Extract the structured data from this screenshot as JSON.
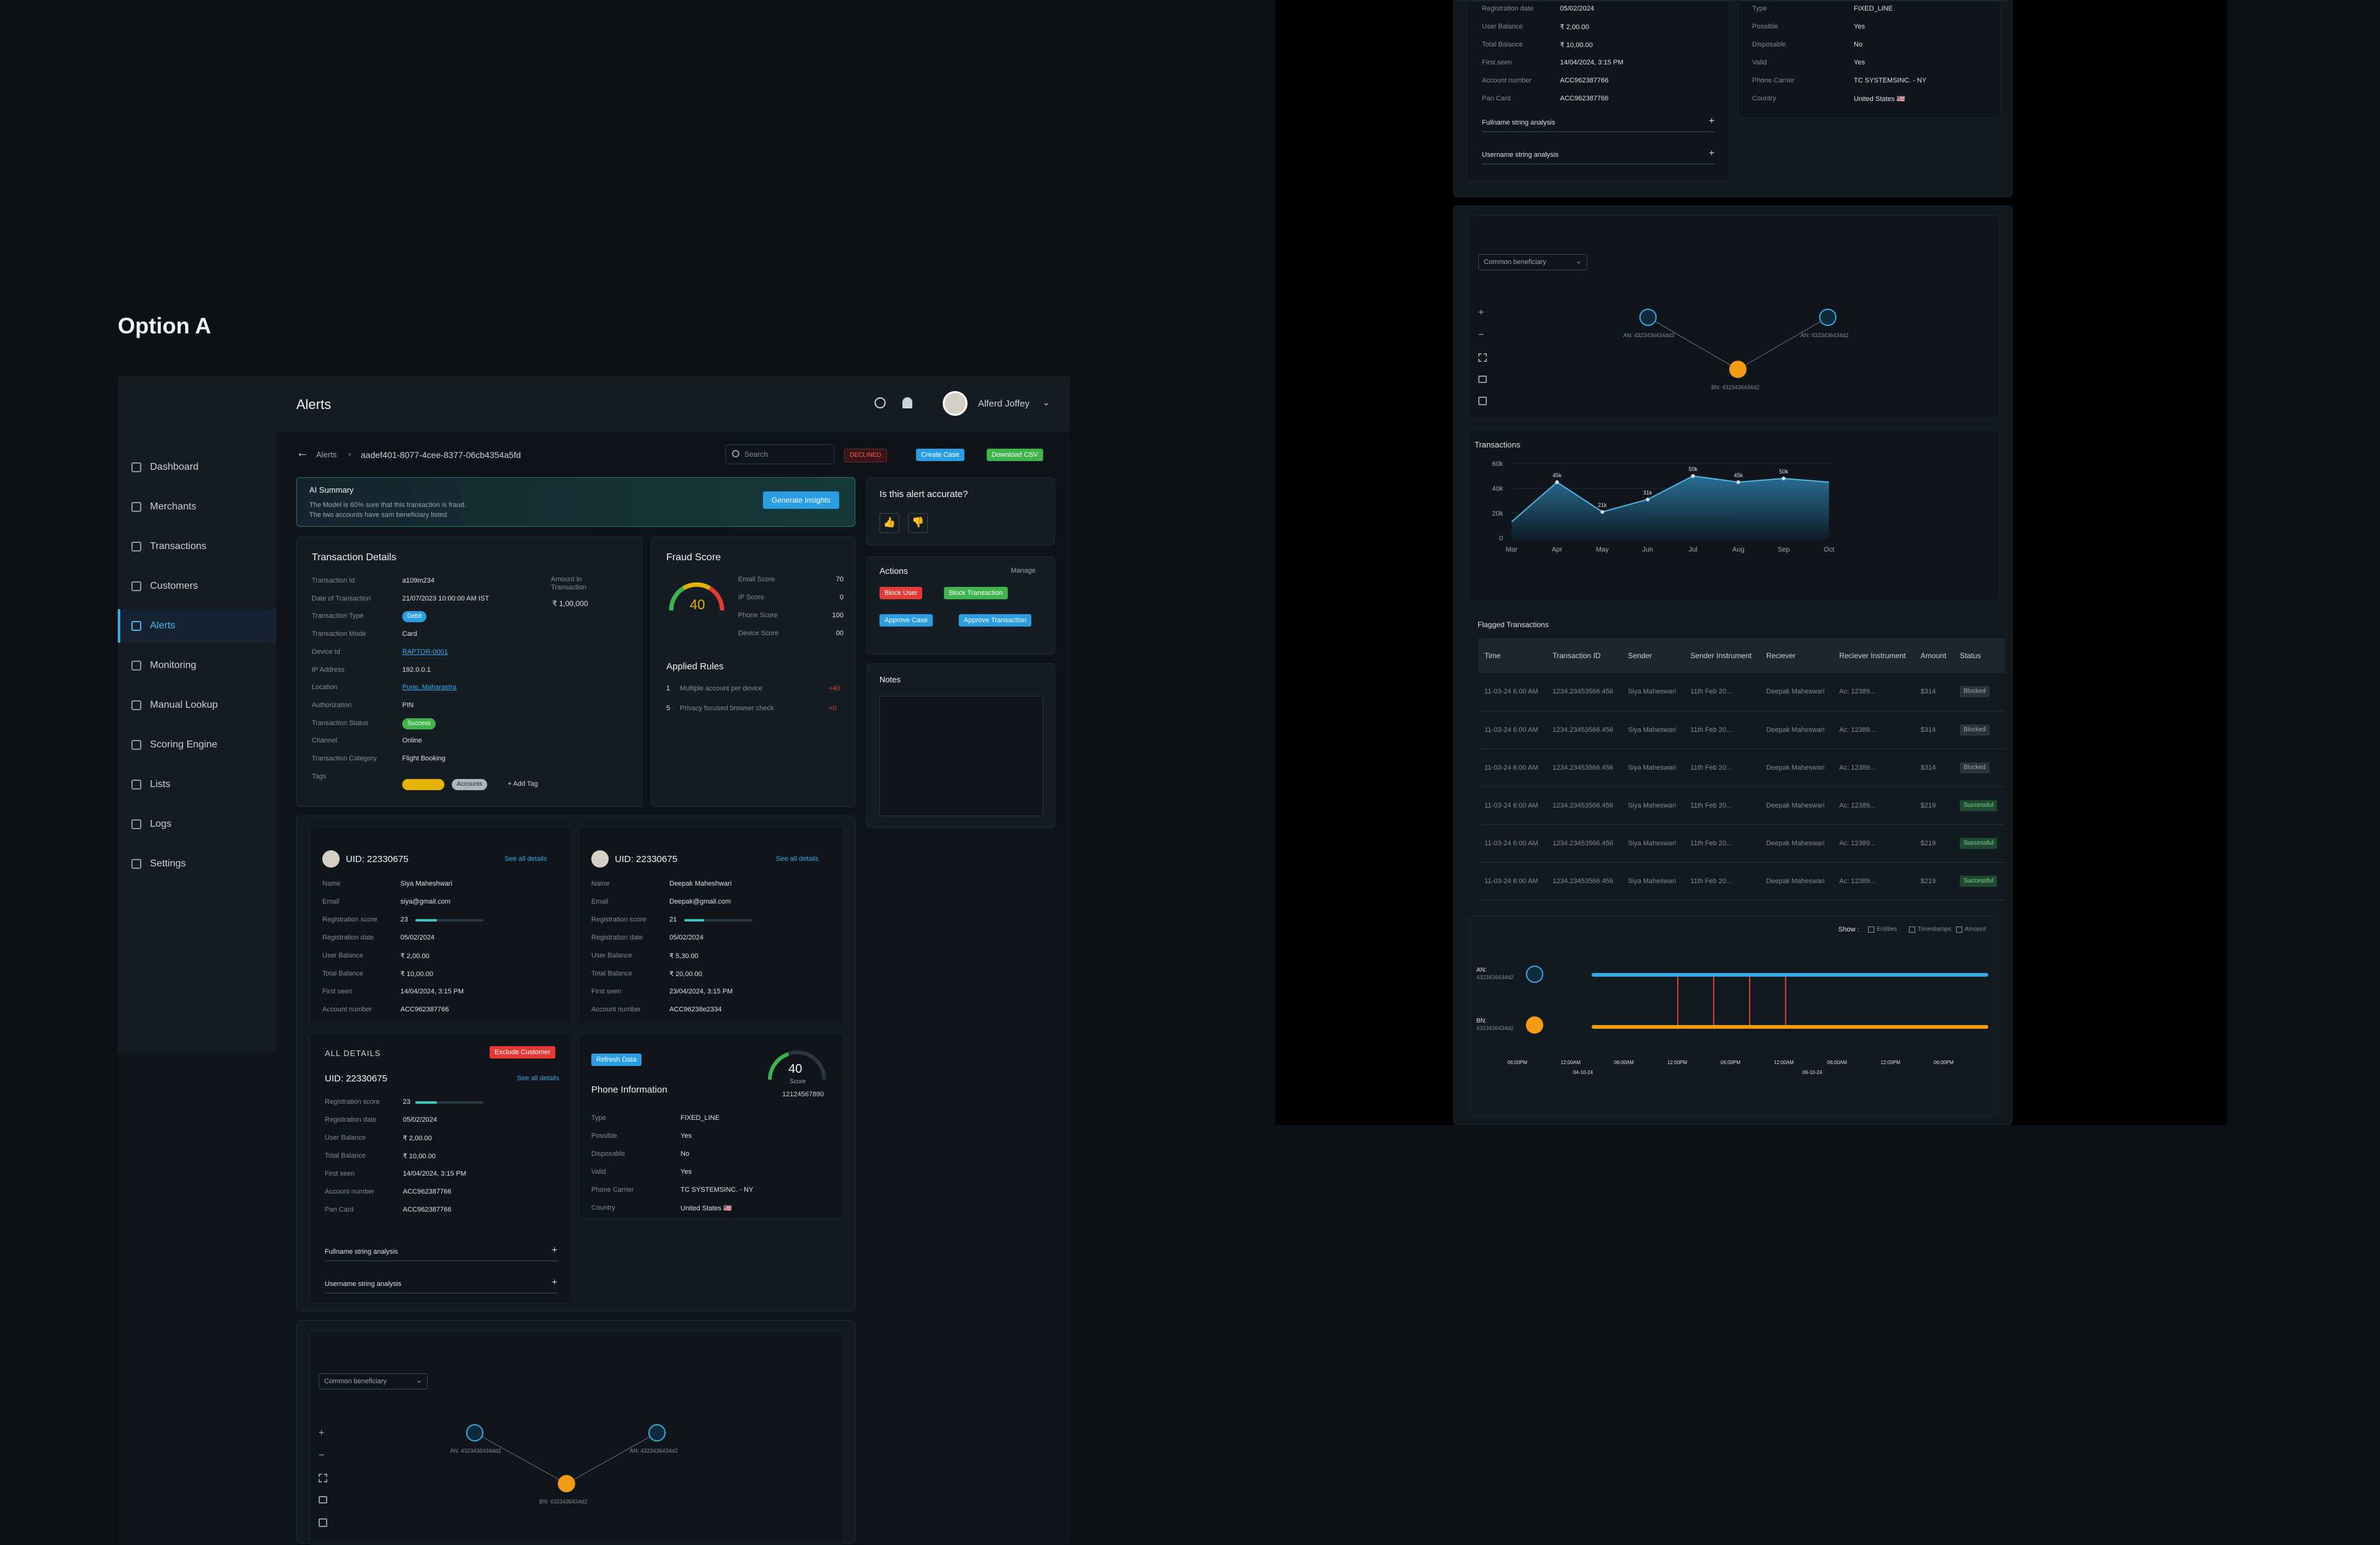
{
  "option_title": "Option A",
  "header": {
    "title": "Alerts",
    "user_name": "Alferd Joffey"
  },
  "sidebar": {
    "items": [
      {
        "label": "Dashboard"
      },
      {
        "label": "Merchants"
      },
      {
        "label": "Transactions"
      },
      {
        "label": "Customers"
      },
      {
        "label": "Alerts"
      },
      {
        "label": "Monitoring"
      },
      {
        "label": "Manual Lookup"
      },
      {
        "label": "Scoring Engine"
      },
      {
        "label": "Lists"
      },
      {
        "label": "Logs"
      },
      {
        "label": "Settings"
      }
    ]
  },
  "breadcrumb": {
    "root": "Alerts",
    "id": "aadef401-8077-4cee-8377-06cb4354a5fd"
  },
  "search": {
    "placeholder": "Search"
  },
  "toolbar": {
    "declined": "DECLINED",
    "create_case": "Create Case",
    "download_csv": "Download CSV"
  },
  "ai_summary": {
    "title": "AI Summary",
    "line1": "The Model is 60% sure that this transaction is fraud.",
    "line2": "The two accounts have sam beneficiary listed",
    "button": "Generate Insights"
  },
  "accuracy": {
    "question": "Is this alert accurate?"
  },
  "actions": {
    "title": "Actions",
    "manage": "Manage",
    "block_user": "Block User",
    "block_transaction": "Block Transaction",
    "approve_case": "Approve Case",
    "approve_transaction": "Approve Transaction"
  },
  "notes": {
    "title": "Notes"
  },
  "transaction_details": {
    "title": "Transaction Details",
    "amount_label": "Amount in Transaction",
    "amount_value": "₹ 1,00,000",
    "rows": [
      {
        "label": "Transaction Id",
        "value": "a109m234"
      },
      {
        "label": "Date of Transaction",
        "value": "21/07/2023 10:00:00 AM IST"
      },
      {
        "label": "Transaction Type",
        "value": "Debit"
      },
      {
        "label": "Transaction Mode",
        "value": "Card"
      },
      {
        "label": "Device Id",
        "value": "RAPTOR-0001"
      },
      {
        "label": "IP Address",
        "value": "192.0.0.1"
      },
      {
        "label": "Location",
        "value": "Pune, Maharastra"
      },
      {
        "label": "Authorization",
        "value": "PIN"
      },
      {
        "label": "Transaction Status",
        "value": "Success"
      },
      {
        "label": "Channel",
        "value": "Online"
      },
      {
        "label": "Transaction Category",
        "value": "Flight Booking"
      },
      {
        "label": "Tags",
        "value": ""
      }
    ],
    "tag_accounts": "Accounts",
    "add_tag": "+ Add Tag"
  },
  "fraud_score": {
    "title": "Fraud Score",
    "score": "40",
    "score_fraction": 0.4,
    "rows": [
      {
        "label": "Email Score",
        "value": "70"
      },
      {
        "label": "IP Score",
        "value": "0"
      },
      {
        "label": "Phone Score",
        "value": "100"
      },
      {
        "label": "Device Score",
        "value": "00"
      }
    ],
    "rules_title": "Applied Rules",
    "rules": [
      {
        "num": "1",
        "text": "Multiple account per device",
        "score": "+40"
      },
      {
        "num": "5",
        "text": "Privacy focused browser check",
        "score": "+0"
      }
    ]
  },
  "customers": [
    {
      "uid": "UID: 22330675",
      "link": "See all details",
      "name": "Siya Maheshwari",
      "email": "siya@gmail.com",
      "reg_score": "23",
      "reg_score_pct": 23,
      "reg_date": "05/02/2024",
      "user_balance": "₹ 2,00.00",
      "total_balance": "₹ 10,00.00",
      "first_seen": "14/04/2024, 3:15 PM",
      "account_number": "ACC962387766"
    },
    {
      "uid": "UID: 22330675",
      "link": "See all details",
      "name": "Deepak Maheshwari",
      "email": "Deepak@gmail.com",
      "reg_score": "21",
      "reg_score_pct": 21,
      "reg_date": "05/02/2024",
      "user_balance": "₹ 5,30.00",
      "total_balance": "₹ 20,00.00",
      "first_seen": "23/04/2024, 3:15 PM",
      "account_number": "ACC96238e2334"
    }
  ],
  "field_labels": {
    "name": "Name",
    "email": "Email",
    "reg_score": "Registration score",
    "reg_date": "Registration date",
    "user_balance": "User Balance",
    "total_balance": "Total Balance",
    "first_seen": "First seen",
    "account_number": "Account number",
    "pan_card": "Pan Card"
  },
  "all_details": {
    "heading": "ALL DETAILS",
    "exclude": "Exclude Customer",
    "uid": "UID: 22330675",
    "link": "See all details",
    "reg_score": "23",
    "reg_score_pct": 23,
    "reg_date": "05/02/2024",
    "user_balance": "₹ 2,00.00",
    "total_balance": "₹ 10,00.00",
    "first_seen": "14/04/2024, 3:15 PM",
    "account_number": "ACC962387766",
    "pan_card": "ACC962387766",
    "fullname_analysis": "Fullname string analysis",
    "username_analysis": "Username string analysis"
  },
  "phone": {
    "refresh": "Refresh Data",
    "title": "Phone Information",
    "score": "40",
    "score_label": "Score",
    "number": "12124567890",
    "rows": [
      {
        "label": "Type",
        "value": "FIXED_LINE"
      },
      {
        "label": "Possible",
        "value": "Yes"
      },
      {
        "label": "Disposable",
        "value": "No"
      },
      {
        "label": "Valid",
        "value": "Yes"
      },
      {
        "label": "Phone Carrier",
        "value": "TC SYSTEMSINC. - NY"
      },
      {
        "label": "Country",
        "value": "United States 🇺🇸"
      }
    ]
  },
  "graph": {
    "dropdown": "Common beneficiary",
    "node_a1": "AN: 4323436434dd2",
    "node_a2": "AN: 4323436434d2",
    "node_b": "BN: 4323436434d2",
    "lbl_an": "AN:",
    "lbl_bn": "BN:"
  },
  "right_top": {
    "rows": [
      {
        "label": "Registration date",
        "value": "05/02/2024"
      },
      {
        "label": "User Balance",
        "value": "₹ 2,00.00"
      },
      {
        "label": "Total Balance",
        "value": "₹ 10,00.00"
      },
      {
        "label": "First seen",
        "value": "14/04/2024, 3:15 PM"
      },
      {
        "label": "Account number",
        "value": "ACC962387766"
      },
      {
        "label": "Pan Card",
        "value": "ACC962387766"
      }
    ],
    "phone_rows": [
      {
        "label": "Type",
        "value": "FIXED_LINE"
      },
      {
        "label": "Possible",
        "value": "Yes"
      },
      {
        "label": "Disposable",
        "value": "No"
      },
      {
        "label": "Valid",
        "value": "Yes"
      },
      {
        "label": "Phone Carrier",
        "value": "TC SYSTEMSINC. - NY"
      },
      {
        "label": "Country",
        "value": "United States 🇺🇸"
      }
    ]
  },
  "transactions_chart": {
    "title": "Transactions"
  },
  "chart_data": {
    "type": "area",
    "title": "Transactions",
    "categories": [
      "Mar",
      "Apr",
      "May",
      "Jun",
      "Jul",
      "Aug",
      "Sep",
      "Oct"
    ],
    "series": [
      {
        "values": [
          13,
          45,
          21,
          31,
          50,
          45,
          48,
          45
        ]
      }
    ],
    "data_labels": [
      "",
      "45k",
      "21k",
      "31k",
      "50k",
      "45k",
      "50k",
      ""
    ],
    "ylim": [
      0,
      60
    ],
    "yticks": [
      "0",
      "20k",
      "40k",
      "60k"
    ],
    "grid": true
  },
  "flagged": {
    "title": "Flagged Transactions",
    "columns": [
      "Time",
      "Transaction ID",
      "Sender",
      "Sender Instrument",
      "Reciever",
      "Reciever Instrument",
      "Amount",
      "Status"
    ],
    "rows": [
      {
        "time": "11-03-24 6:00 AM",
        "id": "1234.23453566.456",
        "sender": "Siya Maheswari",
        "sinst": "11th Feb 20...",
        "recv": "Deepak Maheswari",
        "rinst": "Ac: 12389...",
        "amount": "$314",
        "status": "Blocked",
        "color": "#6b7782"
      },
      {
        "time": "11-03-24 6:00 AM",
        "id": "1234.23453566.456",
        "sender": "Siya Maheswari",
        "sinst": "11th Feb 20...",
        "recv": "Deepak Maheswari",
        "rinst": "Ac: 12389...",
        "amount": "$314",
        "status": "Blocked",
        "color": "#6b7782"
      },
      {
        "time": "11-03-24 6:00 AM",
        "id": "1234.23453566.456",
        "sender": "Siya Maheswari",
        "sinst": "11th Feb 20...",
        "recv": "Deepak Maheswari",
        "rinst": "Ac: 12389...",
        "amount": "$314",
        "status": "Blocked",
        "color": "#6b7782"
      },
      {
        "time": "11-03-24 6:00 AM",
        "id": "1234.23453566.456",
        "sender": "Siya Maheswari",
        "sinst": "11th Feb 20...",
        "recv": "Deepak Maheswari",
        "rinst": "Ac: 12389...",
        "amount": "$219",
        "status": "Successful",
        "color": "#3b8a5a"
      },
      {
        "time": "11-03-24 6:00 AM",
        "id": "1234.23453566.456",
        "sender": "Siya Maheswari",
        "sinst": "11th Feb 20...",
        "recv": "Deepak Maheswari",
        "rinst": "Ac: 12389...",
        "amount": "$219",
        "status": "Successful",
        "color": "#3b8a5a"
      },
      {
        "time": "11-03-24 6:00 AM",
        "id": "1234.23453566.456",
        "sender": "Siya Maheswari",
        "sinst": "11th Feb 20...",
        "recv": "Deepak Maheswari",
        "rinst": "Ac: 12389...",
        "amount": "$219",
        "status": "Successful",
        "color": "#3b8a5a"
      }
    ]
  },
  "timeline": {
    "show": "Show :",
    "opt_entities": "Entities",
    "opt_timestamps": "Timestamps",
    "opt_amount": "Amount",
    "an": "AN:",
    "an_id": "4323436434d2",
    "bn": "BN:",
    "bn_id": "4323436434d2",
    "ticks": [
      "06:00PM",
      "12:00AM",
      "06:00AM",
      "12:00PM",
      "06:00PM",
      "12:00AM",
      "06:00AM",
      "12:00PM",
      "06:00PM"
    ],
    "date1": "04-10-24",
    "date2": "06-10-24"
  },
  "colors": {
    "accent": "#33aee6",
    "green": "#4caf50",
    "red": "#e53935",
    "orange": "#f39c12",
    "teal": "#3ec3c3"
  }
}
